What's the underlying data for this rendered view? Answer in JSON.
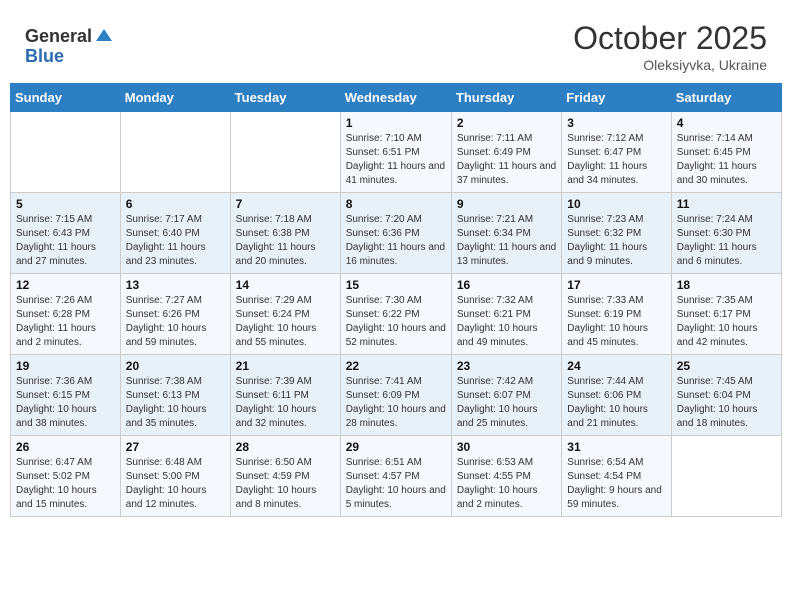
{
  "header": {
    "logo_general": "General",
    "logo_blue": "Blue",
    "month": "October 2025",
    "location": "Oleksiyvka, Ukraine"
  },
  "days_of_week": [
    "Sunday",
    "Monday",
    "Tuesday",
    "Wednesday",
    "Thursday",
    "Friday",
    "Saturday"
  ],
  "weeks": [
    [
      {
        "day": "",
        "content": ""
      },
      {
        "day": "",
        "content": ""
      },
      {
        "day": "",
        "content": ""
      },
      {
        "day": "1",
        "content": "Sunrise: 7:10 AM\nSunset: 6:51 PM\nDaylight: 11 hours and 41 minutes."
      },
      {
        "day": "2",
        "content": "Sunrise: 7:11 AM\nSunset: 6:49 PM\nDaylight: 11 hours and 37 minutes."
      },
      {
        "day": "3",
        "content": "Sunrise: 7:12 AM\nSunset: 6:47 PM\nDaylight: 11 hours and 34 minutes."
      },
      {
        "day": "4",
        "content": "Sunrise: 7:14 AM\nSunset: 6:45 PM\nDaylight: 11 hours and 30 minutes."
      }
    ],
    [
      {
        "day": "5",
        "content": "Sunrise: 7:15 AM\nSunset: 6:43 PM\nDaylight: 11 hours and 27 minutes."
      },
      {
        "day": "6",
        "content": "Sunrise: 7:17 AM\nSunset: 6:40 PM\nDaylight: 11 hours and 23 minutes."
      },
      {
        "day": "7",
        "content": "Sunrise: 7:18 AM\nSunset: 6:38 PM\nDaylight: 11 hours and 20 minutes."
      },
      {
        "day": "8",
        "content": "Sunrise: 7:20 AM\nSunset: 6:36 PM\nDaylight: 11 hours and 16 minutes."
      },
      {
        "day": "9",
        "content": "Sunrise: 7:21 AM\nSunset: 6:34 PM\nDaylight: 11 hours and 13 minutes."
      },
      {
        "day": "10",
        "content": "Sunrise: 7:23 AM\nSunset: 6:32 PM\nDaylight: 11 hours and 9 minutes."
      },
      {
        "day": "11",
        "content": "Sunrise: 7:24 AM\nSunset: 6:30 PM\nDaylight: 11 hours and 6 minutes."
      }
    ],
    [
      {
        "day": "12",
        "content": "Sunrise: 7:26 AM\nSunset: 6:28 PM\nDaylight: 11 hours and 2 minutes."
      },
      {
        "day": "13",
        "content": "Sunrise: 7:27 AM\nSunset: 6:26 PM\nDaylight: 10 hours and 59 minutes."
      },
      {
        "day": "14",
        "content": "Sunrise: 7:29 AM\nSunset: 6:24 PM\nDaylight: 10 hours and 55 minutes."
      },
      {
        "day": "15",
        "content": "Sunrise: 7:30 AM\nSunset: 6:22 PM\nDaylight: 10 hours and 52 minutes."
      },
      {
        "day": "16",
        "content": "Sunrise: 7:32 AM\nSunset: 6:21 PM\nDaylight: 10 hours and 49 minutes."
      },
      {
        "day": "17",
        "content": "Sunrise: 7:33 AM\nSunset: 6:19 PM\nDaylight: 10 hours and 45 minutes."
      },
      {
        "day": "18",
        "content": "Sunrise: 7:35 AM\nSunset: 6:17 PM\nDaylight: 10 hours and 42 minutes."
      }
    ],
    [
      {
        "day": "19",
        "content": "Sunrise: 7:36 AM\nSunset: 6:15 PM\nDaylight: 10 hours and 38 minutes."
      },
      {
        "day": "20",
        "content": "Sunrise: 7:38 AM\nSunset: 6:13 PM\nDaylight: 10 hours and 35 minutes."
      },
      {
        "day": "21",
        "content": "Sunrise: 7:39 AM\nSunset: 6:11 PM\nDaylight: 10 hours and 32 minutes."
      },
      {
        "day": "22",
        "content": "Sunrise: 7:41 AM\nSunset: 6:09 PM\nDaylight: 10 hours and 28 minutes."
      },
      {
        "day": "23",
        "content": "Sunrise: 7:42 AM\nSunset: 6:07 PM\nDaylight: 10 hours and 25 minutes."
      },
      {
        "day": "24",
        "content": "Sunrise: 7:44 AM\nSunset: 6:06 PM\nDaylight: 10 hours and 21 minutes."
      },
      {
        "day": "25",
        "content": "Sunrise: 7:45 AM\nSunset: 6:04 PM\nDaylight: 10 hours and 18 minutes."
      }
    ],
    [
      {
        "day": "26",
        "content": "Sunrise: 6:47 AM\nSunset: 5:02 PM\nDaylight: 10 hours and 15 minutes."
      },
      {
        "day": "27",
        "content": "Sunrise: 6:48 AM\nSunset: 5:00 PM\nDaylight: 10 hours and 12 minutes."
      },
      {
        "day": "28",
        "content": "Sunrise: 6:50 AM\nSunset: 4:59 PM\nDaylight: 10 hours and 8 minutes."
      },
      {
        "day": "29",
        "content": "Sunrise: 6:51 AM\nSunset: 4:57 PM\nDaylight: 10 hours and 5 minutes."
      },
      {
        "day": "30",
        "content": "Sunrise: 6:53 AM\nSunset: 4:55 PM\nDaylight: 10 hours and 2 minutes."
      },
      {
        "day": "31",
        "content": "Sunrise: 6:54 AM\nSunset: 4:54 PM\nDaylight: 9 hours and 59 minutes."
      },
      {
        "day": "",
        "content": ""
      }
    ]
  ]
}
